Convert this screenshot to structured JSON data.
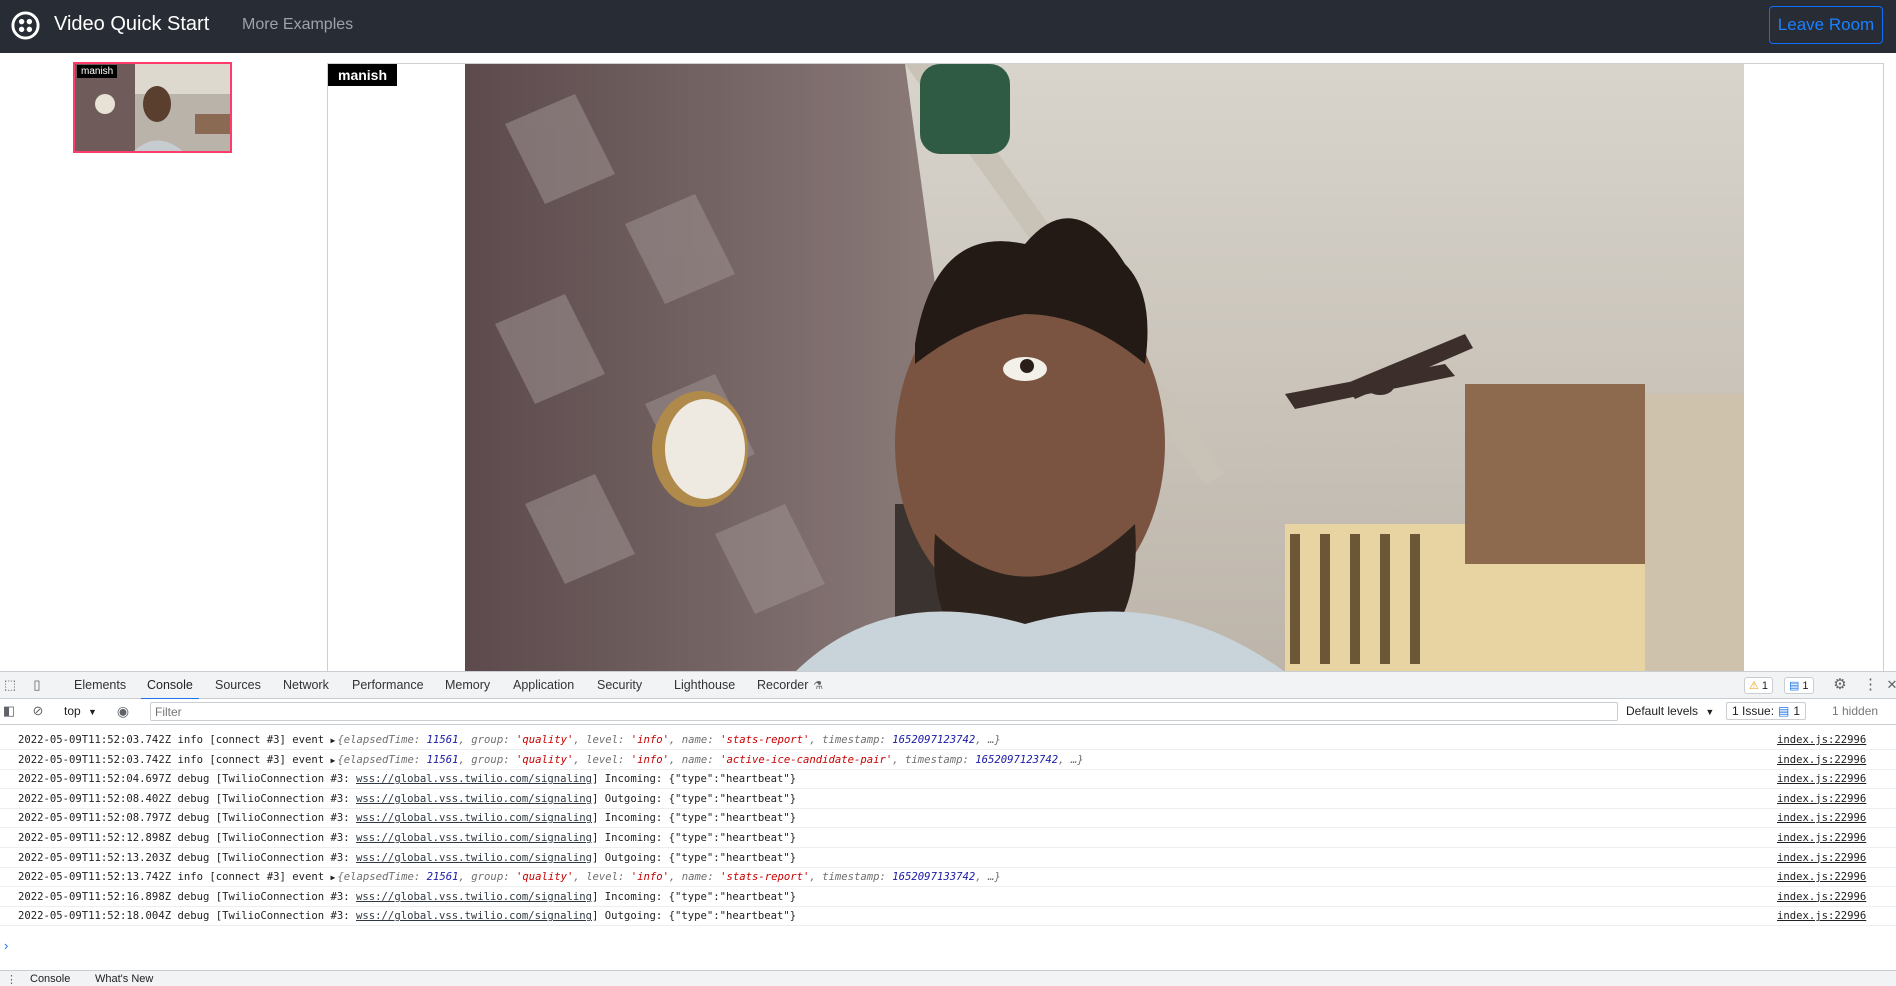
{
  "navbar": {
    "brand": "Video Quick Start",
    "more_examples": "More Examples",
    "leave_room": "Leave Room",
    "logo_icon": "twilio-logo-icon"
  },
  "participants": {
    "local_name": "manish",
    "main_name": "manish"
  },
  "devtools": {
    "tabs": [
      "Elements",
      "Console",
      "Sources",
      "Network",
      "Performance",
      "Memory",
      "Application",
      "Security",
      "Lighthouse",
      "Recorder"
    ],
    "active_tab": "Console",
    "warnings_count": "1",
    "messages_count": "1",
    "context": "top",
    "filter_placeholder": "Filter",
    "levels": "Default levels",
    "issues_label": "1 Issue:",
    "issues_count": "1",
    "hidden": "1 hidden",
    "drawer_tabs": [
      "Console",
      "What's New"
    ],
    "colors": {
      "accent": "#1a73e8",
      "warning": "#f29900",
      "error_border": "#ff3b6b"
    }
  },
  "log": [
    {
      "ts": "2022-05-09T11:52:03.742Z",
      "level": "info",
      "tag": "[connect #3] event",
      "obj": {
        "elapsedTime": "11561",
        "group": "'quality'",
        "levelv": "'info'",
        "name": "'stats-report'",
        "timestamp": "1652097123742"
      },
      "src": "index.js:22996"
    },
    {
      "ts": "2022-05-09T11:52:03.742Z",
      "level": "info",
      "tag": "[connect #3] event",
      "obj": {
        "elapsedTime": "11561",
        "group": "'quality'",
        "levelv": "'info'",
        "name": "'active-ice-candidate-pair'",
        "timestamp": "1652097123742"
      },
      "src": "index.js:22996"
    },
    {
      "ts": "2022-05-09T11:52:04.697Z",
      "level": "debug",
      "tag": "[TwilioConnection #3:",
      "url": "wss://global.vss.twilio.com/signaling",
      "rest": "] Incoming: {\"type\":\"heartbeat\"}",
      "src": "index.js:22996"
    },
    {
      "ts": "2022-05-09T11:52:08.402Z",
      "level": "debug",
      "tag": "[TwilioConnection #3:",
      "url": "wss://global.vss.twilio.com/signaling",
      "rest": "] Outgoing: {\"type\":\"heartbeat\"}",
      "src": "index.js:22996"
    },
    {
      "ts": "2022-05-09T11:52:08.797Z",
      "level": "debug",
      "tag": "[TwilioConnection #3:",
      "url": "wss://global.vss.twilio.com/signaling",
      "rest": "] Incoming: {\"type\":\"heartbeat\"}",
      "src": "index.js:22996"
    },
    {
      "ts": "2022-05-09T11:52:12.898Z",
      "level": "debug",
      "tag": "[TwilioConnection #3:",
      "url": "wss://global.vss.twilio.com/signaling",
      "rest": "] Incoming: {\"type\":\"heartbeat\"}",
      "src": "index.js:22996"
    },
    {
      "ts": "2022-05-09T11:52:13.203Z",
      "level": "debug",
      "tag": "[TwilioConnection #3:",
      "url": "wss://global.vss.twilio.com/signaling",
      "rest": "] Outgoing: {\"type\":\"heartbeat\"}",
      "src": "index.js:22996"
    },
    {
      "ts": "2022-05-09T11:52:13.742Z",
      "level": "info",
      "tag": "[connect #3] event",
      "obj": {
        "elapsedTime": "21561",
        "group": "'quality'",
        "levelv": "'info'",
        "name": "'stats-report'",
        "timestamp": "1652097133742"
      },
      "src": "index.js:22996"
    },
    {
      "ts": "2022-05-09T11:52:16.898Z",
      "level": "debug",
      "tag": "[TwilioConnection #3:",
      "url": "wss://global.vss.twilio.com/signaling",
      "rest": "] Incoming: {\"type\":\"heartbeat\"}",
      "src": "index.js:22996"
    },
    {
      "ts": "2022-05-09T11:52:18.004Z",
      "level": "debug",
      "tag": "[TwilioConnection #3:",
      "url": "wss://global.vss.twilio.com/signaling",
      "rest": "] Outgoing: {\"type\":\"heartbeat\"}",
      "src": "index.js:22996"
    }
  ]
}
